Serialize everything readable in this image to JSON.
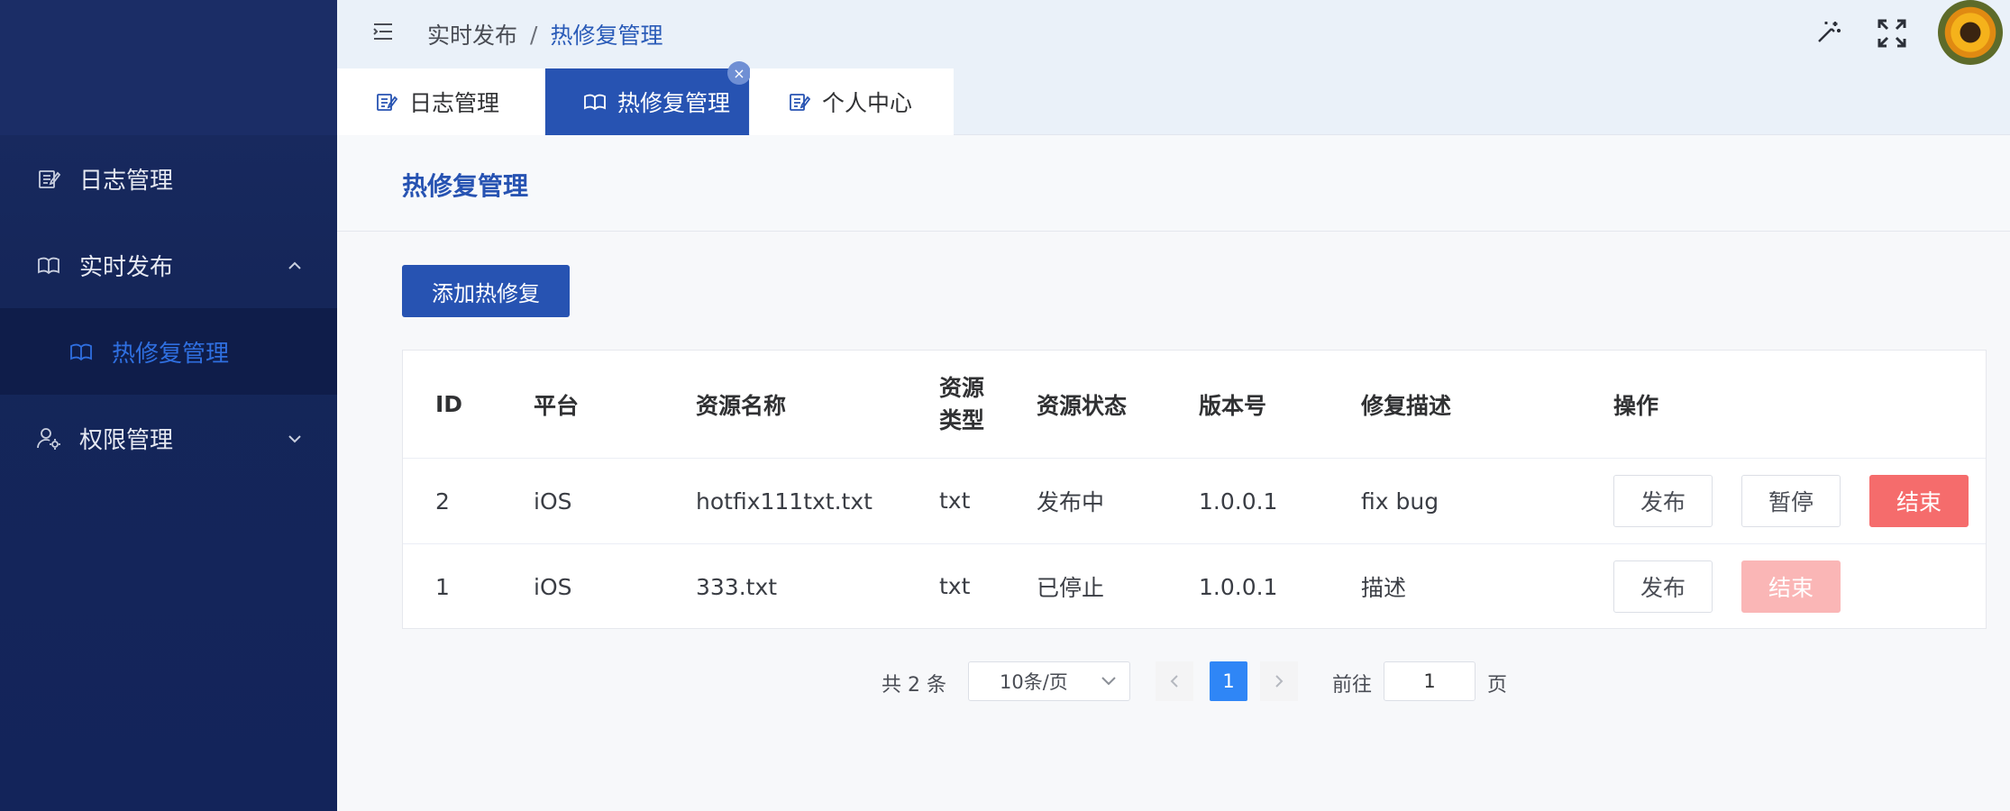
{
  "sidebar": {
    "items": [
      {
        "label": "日志管理",
        "icon": "edit-doc-icon"
      },
      {
        "label": "实时发布",
        "icon": "book-icon",
        "expanded": true,
        "children": [
          {
            "label": "热修复管理",
            "icon": "book-icon",
            "active": true
          }
        ]
      },
      {
        "label": "权限管理",
        "icon": "user-gear-icon",
        "expanded": false
      }
    ]
  },
  "header": {
    "breadcrumb": [
      "实时发布",
      "热修复管理"
    ],
    "breadcrumb_sep": "/"
  },
  "tabs": [
    {
      "label": "日志管理",
      "icon": "edit-doc-icon",
      "active": false
    },
    {
      "label": "热修复管理",
      "icon": "book-icon",
      "active": true,
      "close": "×"
    },
    {
      "label": "个人中心",
      "icon": "edit-doc-icon",
      "active": false
    }
  ],
  "page": {
    "title": "热修复管理",
    "add_button": "添加热修复"
  },
  "table": {
    "columns": [
      "ID",
      "平台",
      "资源名称",
      "资源类型",
      "资源状态",
      "版本号",
      "修复描述",
      "操作"
    ],
    "rows": [
      {
        "id": "2",
        "platform": "iOS",
        "name": "hotfix111txt.txt",
        "type": "txt",
        "status": "发布中",
        "version": "1.0.0.1",
        "desc": "fix bug",
        "actions": [
          "发布",
          "暂停",
          "结束"
        ]
      },
      {
        "id": "1",
        "platform": "iOS",
        "name": "333.txt",
        "type": "txt",
        "status": "已停止",
        "version": "1.0.0.1",
        "desc": "描述",
        "actions": [
          "发布",
          "结束"
        ]
      }
    ]
  },
  "pagination": {
    "total": "共 2 条",
    "page_size": "10条/页",
    "current": "1",
    "goto_label": "前往",
    "goto_value": "1",
    "page_suffix": "页"
  },
  "colors": {
    "primary": "#2753b2",
    "sidebar_bg": "#152659",
    "danger": "#f56c6c",
    "danger_disabled": "#fab6b6",
    "pager_active": "#2f86f6"
  }
}
